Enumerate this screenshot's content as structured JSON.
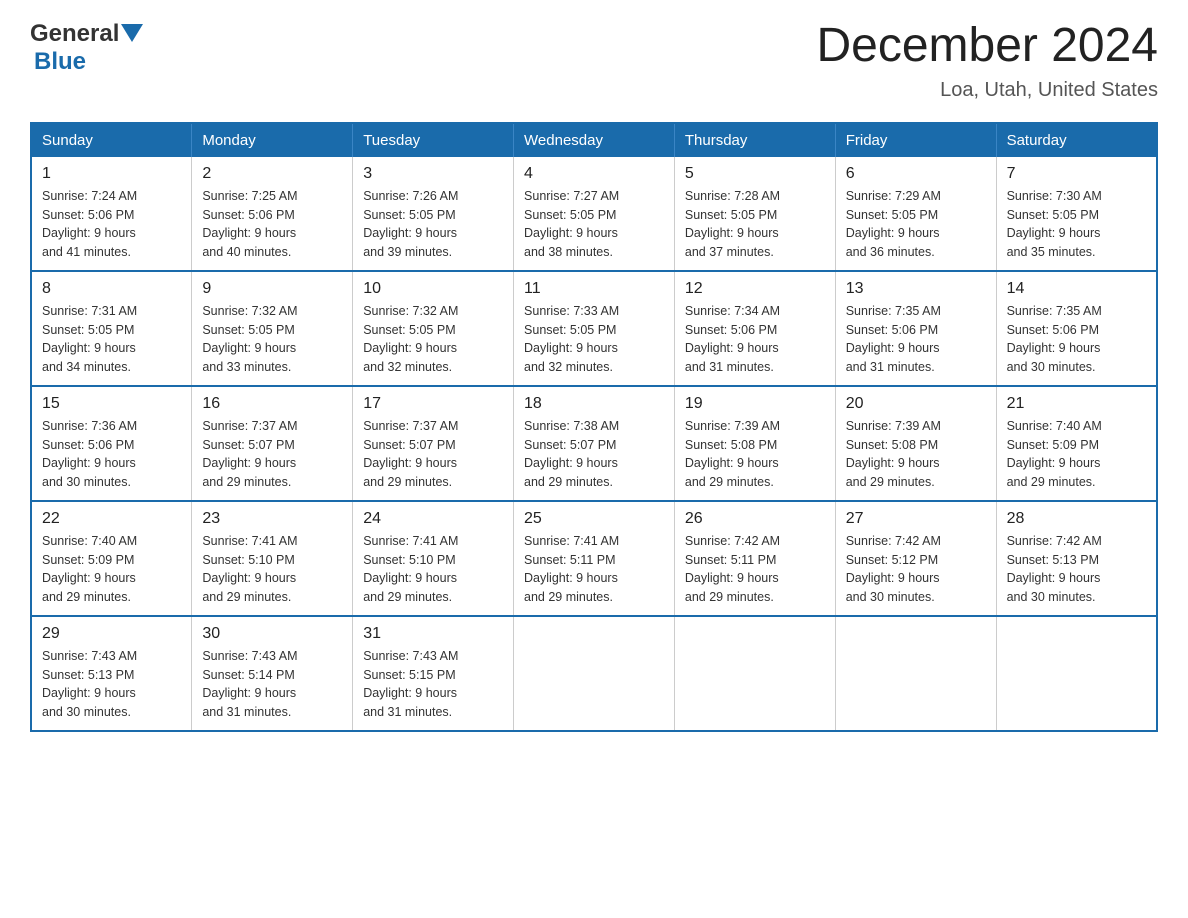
{
  "header": {
    "logo_general": "General",
    "logo_blue": "Blue",
    "title": "December 2024",
    "subtitle": "Loa, Utah, United States"
  },
  "weekdays": [
    "Sunday",
    "Monday",
    "Tuesday",
    "Wednesday",
    "Thursday",
    "Friday",
    "Saturday"
  ],
  "weeks": [
    [
      {
        "day": "1",
        "sunrise": "7:24 AM",
        "sunset": "5:06 PM",
        "daylight": "9 hours and 41 minutes."
      },
      {
        "day": "2",
        "sunrise": "7:25 AM",
        "sunset": "5:06 PM",
        "daylight": "9 hours and 40 minutes."
      },
      {
        "day": "3",
        "sunrise": "7:26 AM",
        "sunset": "5:05 PM",
        "daylight": "9 hours and 39 minutes."
      },
      {
        "day": "4",
        "sunrise": "7:27 AM",
        "sunset": "5:05 PM",
        "daylight": "9 hours and 38 minutes."
      },
      {
        "day": "5",
        "sunrise": "7:28 AM",
        "sunset": "5:05 PM",
        "daylight": "9 hours and 37 minutes."
      },
      {
        "day": "6",
        "sunrise": "7:29 AM",
        "sunset": "5:05 PM",
        "daylight": "9 hours and 36 minutes."
      },
      {
        "day": "7",
        "sunrise": "7:30 AM",
        "sunset": "5:05 PM",
        "daylight": "9 hours and 35 minutes."
      }
    ],
    [
      {
        "day": "8",
        "sunrise": "7:31 AM",
        "sunset": "5:05 PM",
        "daylight": "9 hours and 34 minutes."
      },
      {
        "day": "9",
        "sunrise": "7:32 AM",
        "sunset": "5:05 PM",
        "daylight": "9 hours and 33 minutes."
      },
      {
        "day": "10",
        "sunrise": "7:32 AM",
        "sunset": "5:05 PM",
        "daylight": "9 hours and 32 minutes."
      },
      {
        "day": "11",
        "sunrise": "7:33 AM",
        "sunset": "5:05 PM",
        "daylight": "9 hours and 32 minutes."
      },
      {
        "day": "12",
        "sunrise": "7:34 AM",
        "sunset": "5:06 PM",
        "daylight": "9 hours and 31 minutes."
      },
      {
        "day": "13",
        "sunrise": "7:35 AM",
        "sunset": "5:06 PM",
        "daylight": "9 hours and 31 minutes."
      },
      {
        "day": "14",
        "sunrise": "7:35 AM",
        "sunset": "5:06 PM",
        "daylight": "9 hours and 30 minutes."
      }
    ],
    [
      {
        "day": "15",
        "sunrise": "7:36 AM",
        "sunset": "5:06 PM",
        "daylight": "9 hours and 30 minutes."
      },
      {
        "day": "16",
        "sunrise": "7:37 AM",
        "sunset": "5:07 PM",
        "daylight": "9 hours and 29 minutes."
      },
      {
        "day": "17",
        "sunrise": "7:37 AM",
        "sunset": "5:07 PM",
        "daylight": "9 hours and 29 minutes."
      },
      {
        "day": "18",
        "sunrise": "7:38 AM",
        "sunset": "5:07 PM",
        "daylight": "9 hours and 29 minutes."
      },
      {
        "day": "19",
        "sunrise": "7:39 AM",
        "sunset": "5:08 PM",
        "daylight": "9 hours and 29 minutes."
      },
      {
        "day": "20",
        "sunrise": "7:39 AM",
        "sunset": "5:08 PM",
        "daylight": "9 hours and 29 minutes."
      },
      {
        "day": "21",
        "sunrise": "7:40 AM",
        "sunset": "5:09 PM",
        "daylight": "9 hours and 29 minutes."
      }
    ],
    [
      {
        "day": "22",
        "sunrise": "7:40 AM",
        "sunset": "5:09 PM",
        "daylight": "9 hours and 29 minutes."
      },
      {
        "day": "23",
        "sunrise": "7:41 AM",
        "sunset": "5:10 PM",
        "daylight": "9 hours and 29 minutes."
      },
      {
        "day": "24",
        "sunrise": "7:41 AM",
        "sunset": "5:10 PM",
        "daylight": "9 hours and 29 minutes."
      },
      {
        "day": "25",
        "sunrise": "7:41 AM",
        "sunset": "5:11 PM",
        "daylight": "9 hours and 29 minutes."
      },
      {
        "day": "26",
        "sunrise": "7:42 AM",
        "sunset": "5:11 PM",
        "daylight": "9 hours and 29 minutes."
      },
      {
        "day": "27",
        "sunrise": "7:42 AM",
        "sunset": "5:12 PM",
        "daylight": "9 hours and 30 minutes."
      },
      {
        "day": "28",
        "sunrise": "7:42 AM",
        "sunset": "5:13 PM",
        "daylight": "9 hours and 30 minutes."
      }
    ],
    [
      {
        "day": "29",
        "sunrise": "7:43 AM",
        "sunset": "5:13 PM",
        "daylight": "9 hours and 30 minutes."
      },
      {
        "day": "30",
        "sunrise": "7:43 AM",
        "sunset": "5:14 PM",
        "daylight": "9 hours and 31 minutes."
      },
      {
        "day": "31",
        "sunrise": "7:43 AM",
        "sunset": "5:15 PM",
        "daylight": "9 hours and 31 minutes."
      },
      null,
      null,
      null,
      null
    ]
  ],
  "labels": {
    "sunrise": "Sunrise:",
    "sunset": "Sunset:",
    "daylight": "Daylight:"
  }
}
